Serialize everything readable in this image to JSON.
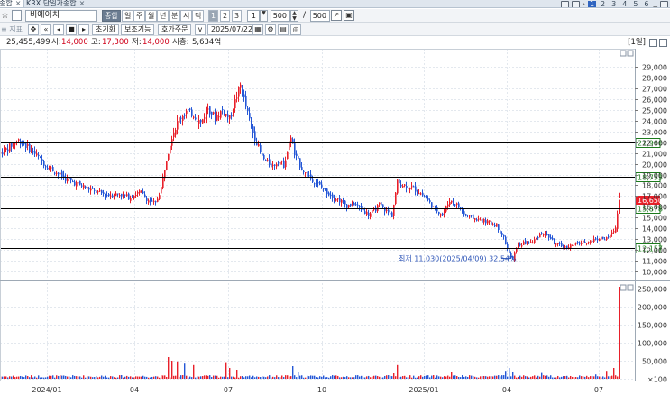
{
  "tabs": [
    {
      "label": "종합",
      "close": "×"
    },
    {
      "label": "KRX 단일가종합",
      "close": "×"
    }
  ],
  "window_controls": {
    "pages": [
      "1",
      "2",
      "3",
      "4",
      "5",
      "6"
    ],
    "active_page": "1"
  },
  "toolbar": {
    "stock_name": "비에이치",
    "periods": [
      "종합",
      "일",
      "주",
      "월",
      "년",
      "분",
      "시",
      "틱"
    ],
    "active_period": "종합",
    "period_numbers": [
      "1",
      "2",
      "3"
    ],
    "active_number": "1",
    "unit_value": "1",
    "count_value": "500",
    "total_count": "500",
    "slash": "/"
  },
  "toolbar2": {
    "label": "≡ 지표",
    "init_button": "초기화",
    "aux_button": "보조기능",
    "order_button": "호가주문",
    "date_value": "2025/07/22"
  },
  "info_line": {
    "volume": "25,455,499",
    "open_label": "시:",
    "open_value": "14,000",
    "high_label": "고:",
    "high_value": "17,300",
    "low_label": "저:",
    "low_value": "14,000",
    "marketcap_label": "시총:",
    "marketcap_value": "5,634억",
    "interval": "[1일]"
  },
  "chart_data": {
    "type": "candlestick",
    "price_axis": {
      "ticks": [
        10000,
        11000,
        12000,
        13000,
        14000,
        15000,
        16000,
        17000,
        18000,
        19000,
        20000,
        21000,
        22000,
        23000,
        24000,
        25000,
        26000,
        27000,
        28000,
        29000
      ],
      "ylim": [
        9400,
        30200
      ]
    },
    "volume_axis": {
      "ticks": [
        100,
        50000,
        100000,
        150000,
        200000,
        250000
      ],
      "tick_labels": [
        "×100",
        "50,000",
        "100,000",
        "150,000",
        "200,000",
        "250,000"
      ],
      "ylim": [
        0,
        265000
      ]
    },
    "x_labels": [
      "2024/01",
      "04",
      "07",
      "10",
      "2025/01",
      "04",
      "07"
    ],
    "horizontal_lines": [
      {
        "value": 21966,
        "label": "21,966"
      },
      {
        "value": 18753,
        "label": "18,753"
      },
      {
        "value": 15878,
        "label": "15,878"
      },
      {
        "value": 12157,
        "label": "12,157"
      }
    ],
    "current_price_label": "16,650",
    "min_annotation": "최저 11,030(2025/04/09) 32.54%",
    "price_path": [
      [
        0,
        21000
      ],
      [
        10,
        21600
      ],
      [
        20,
        22200
      ],
      [
        28,
        21700
      ],
      [
        35,
        21200
      ],
      [
        42,
        20600
      ],
      [
        50,
        19900
      ],
      [
        60,
        19300
      ],
      [
        70,
        18700
      ],
      [
        80,
        18300
      ],
      [
        92,
        17900
      ],
      [
        105,
        17400
      ],
      [
        118,
        17100
      ],
      [
        132,
        17200
      ],
      [
        142,
        16900
      ],
      [
        155,
        17400
      ],
      [
        165,
        16500
      ],
      [
        172,
        16300
      ],
      [
        178,
        17800
      ],
      [
        184,
        20500
      ],
      [
        190,
        22600
      ],
      [
        198,
        24200
      ],
      [
        206,
        24900
      ],
      [
        214,
        24600
      ],
      [
        222,
        23800
      ],
      [
        230,
        25200
      ],
      [
        238,
        24300
      ],
      [
        246,
        25000
      ],
      [
        254,
        24200
      ],
      [
        260,
        25800
      ],
      [
        266,
        27300
      ],
      [
        272,
        25300
      ],
      [
        278,
        23400
      ],
      [
        284,
        22000
      ],
      [
        290,
        20600
      ],
      [
        296,
        20100
      ],
      [
        302,
        19800
      ],
      [
        308,
        20300
      ],
      [
        314,
        19900
      ],
      [
        318,
        21200
      ],
      [
        322,
        22600
      ],
      [
        326,
        20800
      ],
      [
        332,
        19900
      ],
      [
        338,
        19100
      ],
      [
        344,
        18700
      ],
      [
        352,
        18100
      ],
      [
        360,
        17500
      ],
      [
        368,
        17000
      ],
      [
        376,
        16600
      ],
      [
        384,
        16100
      ],
      [
        392,
        16300
      ],
      [
        400,
        15800
      ],
      [
        408,
        15300
      ],
      [
        414,
        15600
      ],
      [
        420,
        16200
      ],
      [
        428,
        15600
      ],
      [
        434,
        15200
      ],
      [
        440,
        18300
      ],
      [
        448,
        18000
      ],
      [
        456,
        17800
      ],
      [
        464,
        17400
      ],
      [
        472,
        16800
      ],
      [
        480,
        15900
      ],
      [
        490,
        15300
      ],
      [
        498,
        16600
      ],
      [
        506,
        16200
      ],
      [
        514,
        15300
      ],
      [
        522,
        15000
      ],
      [
        530,
        14800
      ],
      [
        540,
        14600
      ],
      [
        550,
        14300
      ],
      [
        558,
        13100
      ],
      [
        564,
        11600
      ],
      [
        568,
        11030
      ],
      [
        572,
        12300
      ],
      [
        580,
        12600
      ],
      [
        590,
        12700
      ],
      [
        600,
        13600
      ],
      [
        608,
        13200
      ],
      [
        616,
        12500
      ],
      [
        626,
        12200
      ],
      [
        636,
        12500
      ],
      [
        646,
        12700
      ],
      [
        656,
        12900
      ],
      [
        664,
        13100
      ],
      [
        672,
        13000
      ],
      [
        678,
        13500
      ],
      [
        682,
        14100
      ],
      [
        686,
        16650
      ]
    ],
    "volume_spikes": [
      [
        183,
        145000
      ],
      [
        186,
        60000
      ],
      [
        190,
        50000
      ],
      [
        196,
        48000
      ],
      [
        204,
        42000
      ],
      [
        214,
        38000
      ],
      [
        250,
        46000
      ],
      [
        254,
        30000
      ],
      [
        262,
        25000
      ],
      [
        324,
        35000
      ],
      [
        330,
        20000
      ],
      [
        440,
        38000
      ],
      [
        436,
        15000
      ],
      [
        500,
        20000
      ],
      [
        560,
        22000
      ],
      [
        564,
        30000
      ],
      [
        568,
        18000
      ],
      [
        600,
        16000
      ],
      [
        660,
        12000
      ],
      [
        672,
        22000
      ],
      [
        680,
        30000
      ],
      [
        686,
        255000
      ]
    ]
  },
  "colors": {
    "up": "#e8202a",
    "down": "#2557d6",
    "line_label_bg": "#ffffff",
    "line_label_text": "#1c7a1c",
    "current_label_bg": "#e8202a"
  }
}
